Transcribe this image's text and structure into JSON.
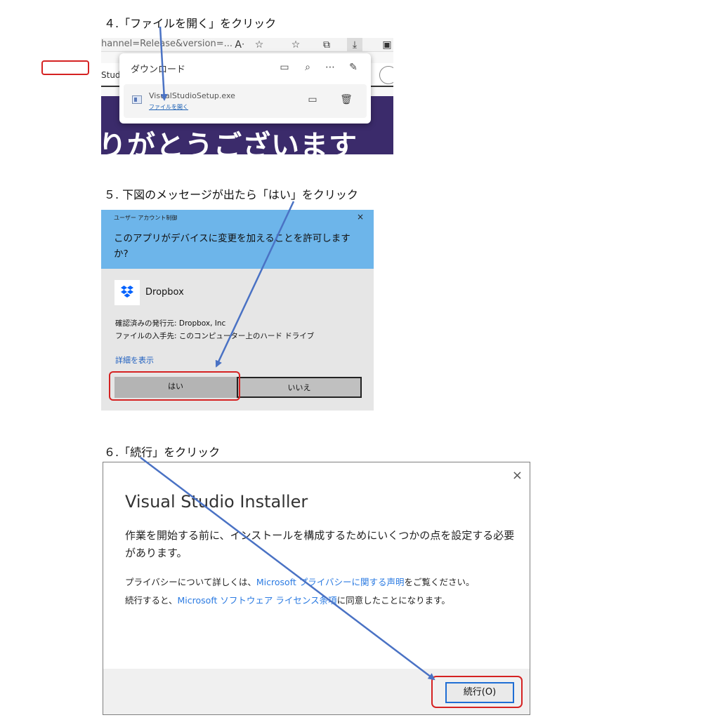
{
  "steps": {
    "step4_title": "４.「ファイルを開く」をクリック",
    "step5_title": "５. 下図のメッセージが出たら「はい」をクリック",
    "step6_title": "６.「続行」をクリック"
  },
  "browser": {
    "address_text": "hannel=Release&version=...",
    "reader_icon_text": "A̅",
    "page_nav_text": "Stud",
    "hero_text": "りがとうございます",
    "download_panel": {
      "title": "ダウンロード",
      "filename": "VisualStudioSetup.exe",
      "open_file_link": "ファイルを開く"
    }
  },
  "uac": {
    "caption": "ユーザー アカウント制御",
    "close_glyph": "×",
    "question": "このアプリがデバイスに変更を加えることを許可しますか?",
    "app_name": "Dropbox",
    "publisher": "確認済みの発行元: Dropbox, Inc",
    "origin": "ファイルの入手先: このコンピューター上のハード ドライブ",
    "details_link": "詳細を表示",
    "yes_label": "はい",
    "no_label": "いいえ",
    "brand_color": "#0061fe"
  },
  "installer": {
    "title": "Visual Studio Installer",
    "close_glyph": "×",
    "body": "作業を開始する前に、インストールを構成するためにいくつかの点を設定する必要があります。",
    "privacy_prefix": "プライバシーについて詳しくは、",
    "privacy_link": "Microsoft プライバシーに関する声明",
    "privacy_suffix": "をご覧ください。",
    "license_prefix": "続行すると、",
    "license_link": "Microsoft ソフトウェア ライセンス条項",
    "license_suffix": "に同意したことになります。",
    "continue_label": "続行(O)"
  },
  "annotations": {
    "highlight_color": "#d52222",
    "arrow_color": "#4a72c4"
  }
}
